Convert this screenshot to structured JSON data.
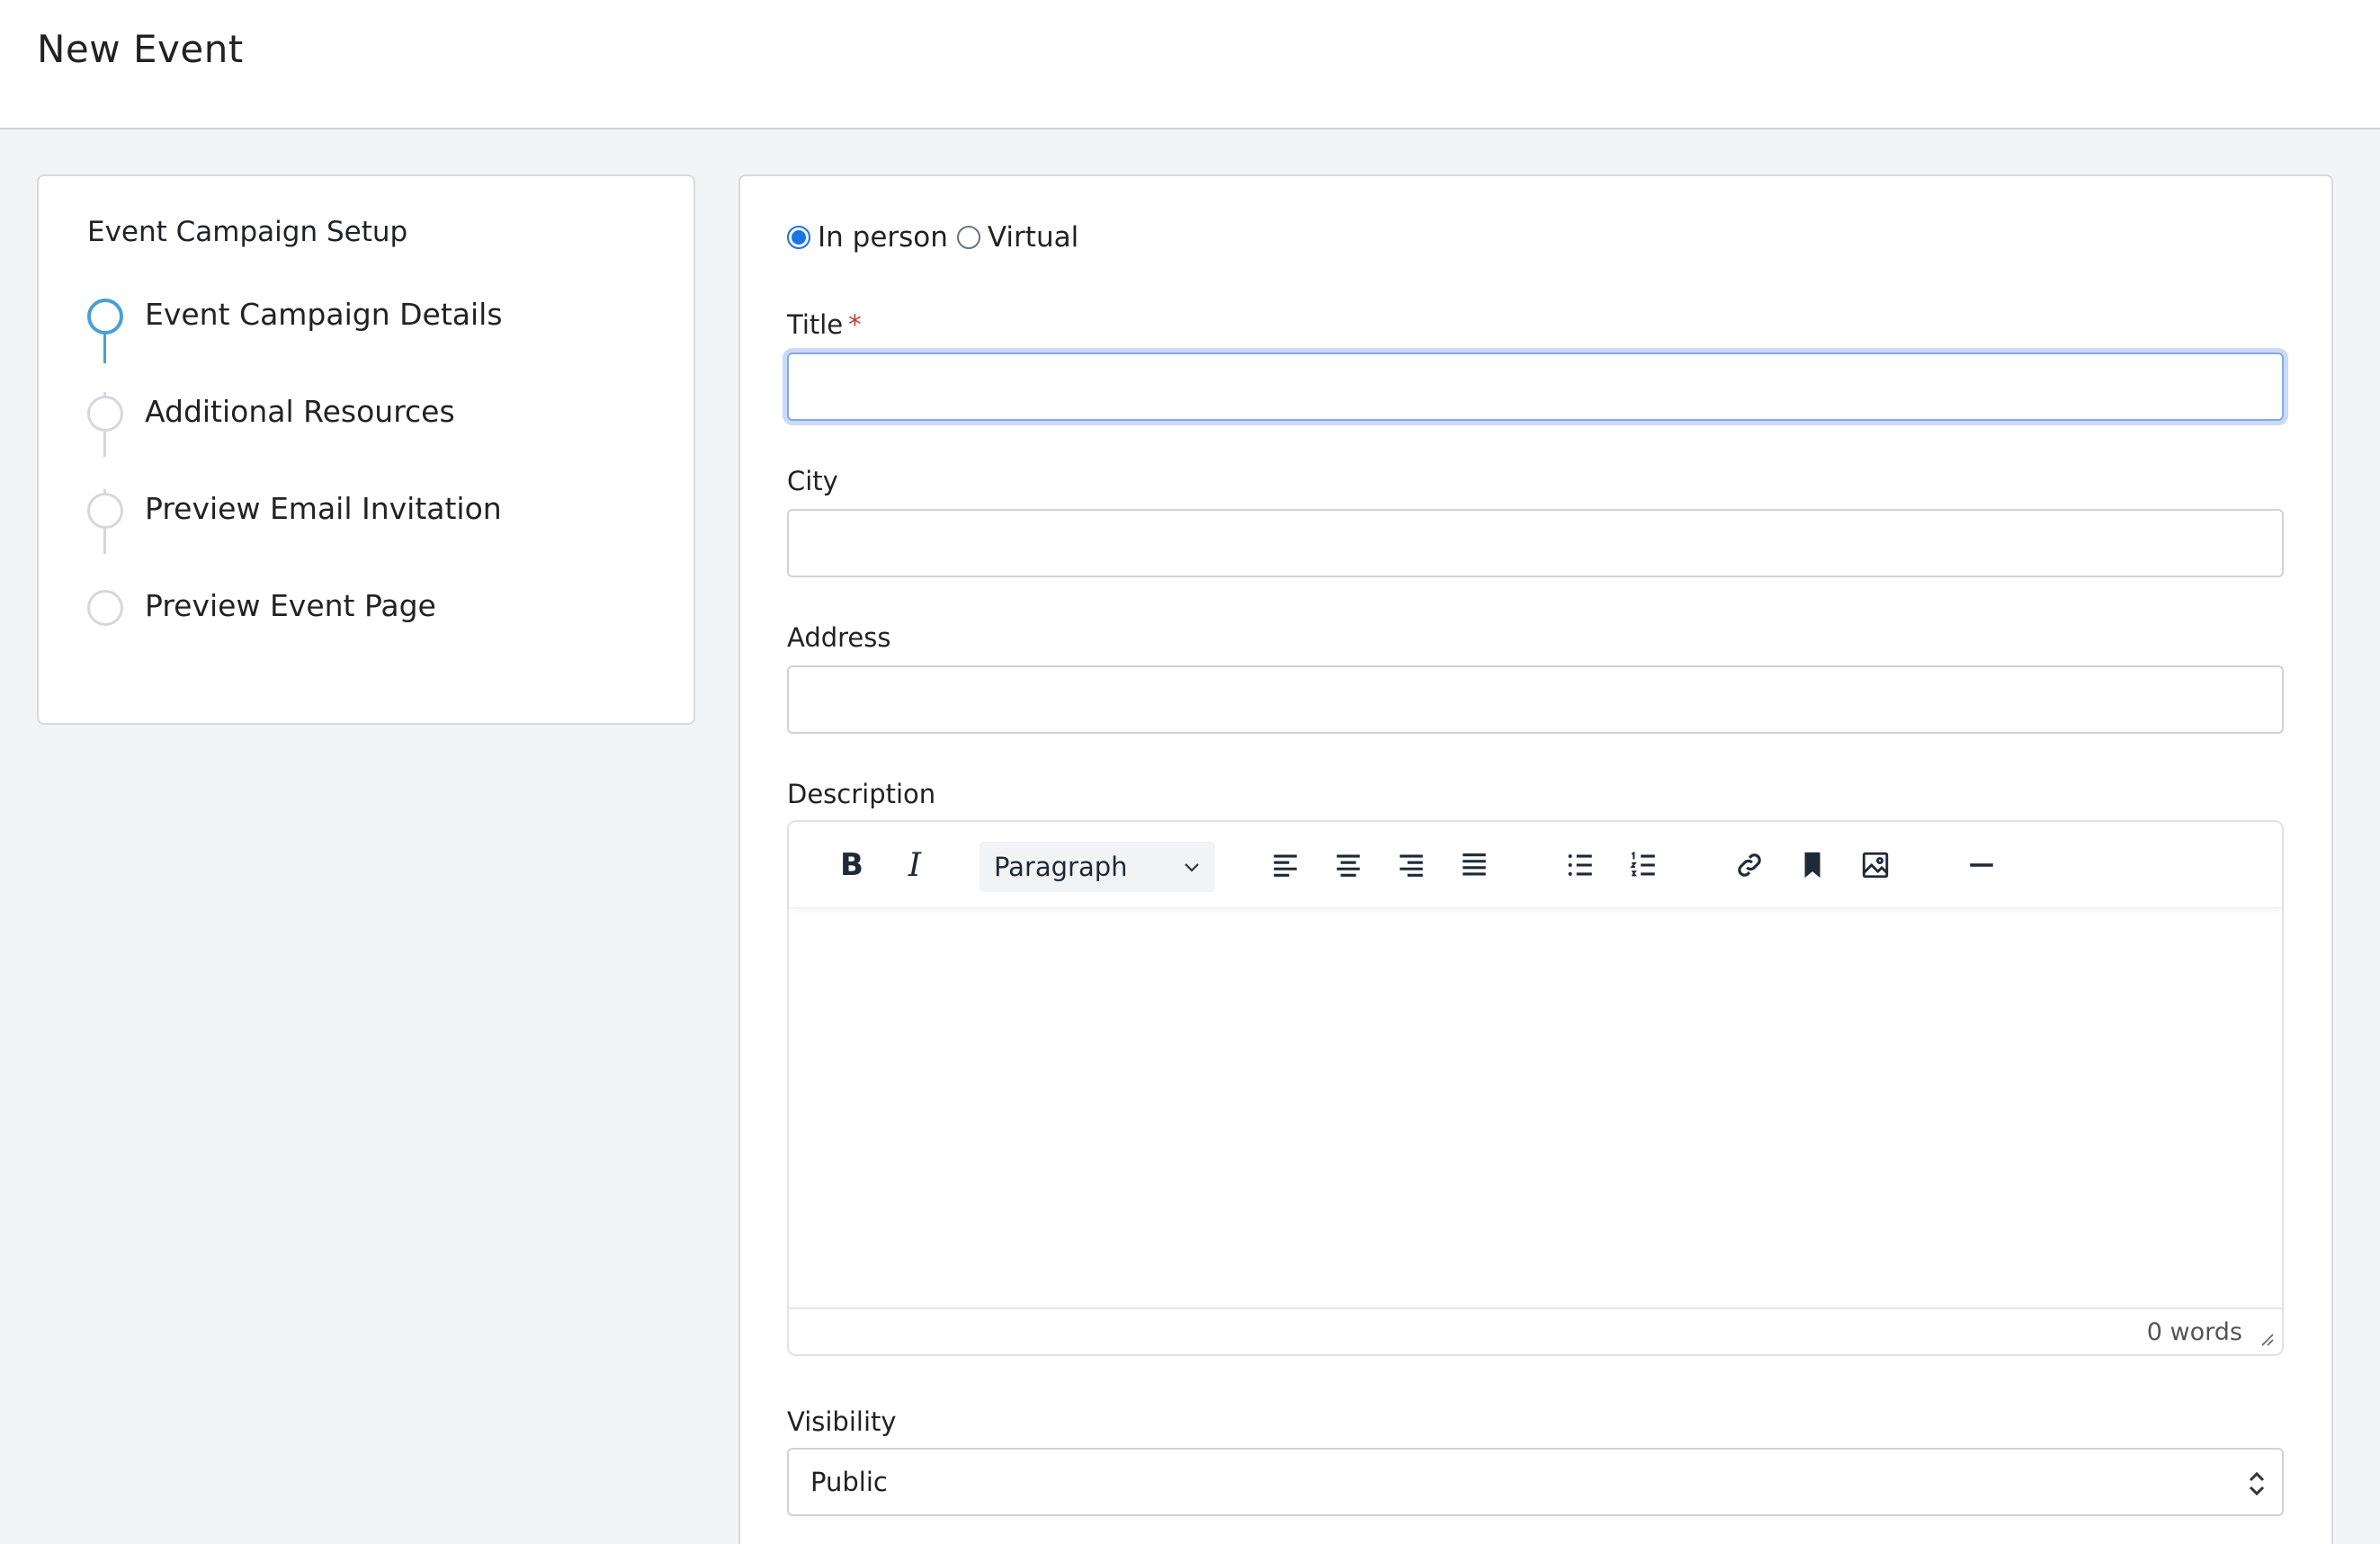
{
  "header": {
    "title": "New Event"
  },
  "steps": {
    "title": "Event Campaign Setup",
    "items": [
      {
        "label": "Event Campaign Details",
        "active": true
      },
      {
        "label": "Additional Resources",
        "active": false
      },
      {
        "label": "Preview Email Invitation",
        "active": false
      },
      {
        "label": "Preview Event Page",
        "active": false
      }
    ]
  },
  "form": {
    "location_type": {
      "options": [
        {
          "label": "In person",
          "checked": true
        },
        {
          "label": "Virtual",
          "checked": false
        }
      ]
    },
    "title": {
      "label": "Title",
      "required_mark": "*",
      "value": ""
    },
    "city": {
      "label": "City",
      "value": ""
    },
    "address": {
      "label": "Address",
      "value": ""
    },
    "description": {
      "label": "Description",
      "toolbar": {
        "bold": "B",
        "italic": "I",
        "block_format": "Paragraph",
        "icons": [
          "align-left-icon",
          "align-center-icon",
          "align-right-icon",
          "align-justify-icon",
          "bulleted-list-icon",
          "numbered-list-icon",
          "link-icon",
          "bookmark-icon",
          "image-icon",
          "horizontal-rule-icon"
        ]
      },
      "word_count": "0 words"
    },
    "visibility": {
      "label": "Visibility",
      "value": "Public"
    }
  },
  "colors": {
    "accent": "#4a9fd8",
    "radio_checked": "#1a73e8",
    "required": "#c0392b",
    "focus_ring": "#86a8e7"
  }
}
